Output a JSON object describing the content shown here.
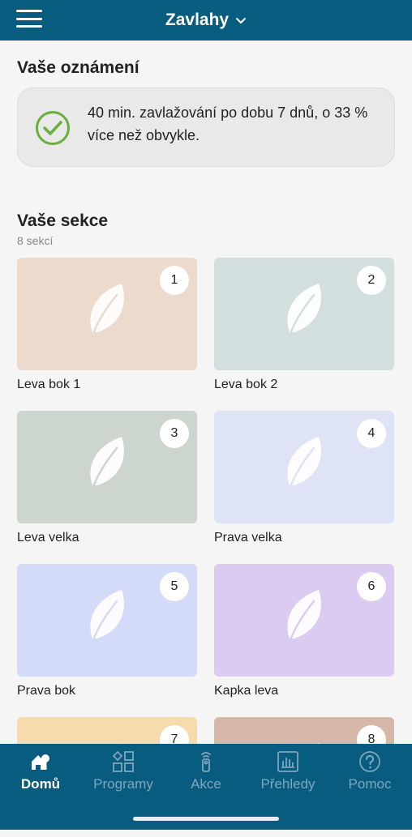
{
  "header": {
    "title": "Zavlahy"
  },
  "notifications": {
    "heading": "Vaše oznámení",
    "message": "40 min. zavlažování po dobu 7 dnů, o 33 % více než obvykle."
  },
  "sections": {
    "heading": "Vaše sekce",
    "count": "8 sekcí",
    "zones": [
      {
        "number": "1",
        "name": "Leva bok 1",
        "color": "#ecdacd"
      },
      {
        "number": "2",
        "name": "Leva bok 2",
        "color": "#d3dfdf"
      },
      {
        "number": "3",
        "name": "Leva velka",
        "color": "#ccd6cf"
      },
      {
        "number": "4",
        "name": "Prava velka",
        "color": "#dee4f6"
      },
      {
        "number": "5",
        "name": "Prava bok",
        "color": "#d3dbf8"
      },
      {
        "number": "6",
        "name": "Kapka leva",
        "color": "#dccbf1"
      },
      {
        "number": "7",
        "name": "",
        "color": "#f6dcad"
      },
      {
        "number": "8",
        "name": "",
        "color": "#d6b8a9"
      }
    ]
  },
  "tabs": [
    {
      "label": "Domů",
      "icon": "home-icon"
    },
    {
      "label": "Programy",
      "icon": "grid-icon"
    },
    {
      "label": "Akce",
      "icon": "remote-icon"
    },
    {
      "label": "Přehledy",
      "icon": "chart-icon"
    },
    {
      "label": "Pomoc",
      "icon": "help-icon"
    }
  ],
  "colors": {
    "header": "#075c80",
    "accent_green": "#6aaf3d",
    "inactive_tab": "#7fa6bd"
  }
}
